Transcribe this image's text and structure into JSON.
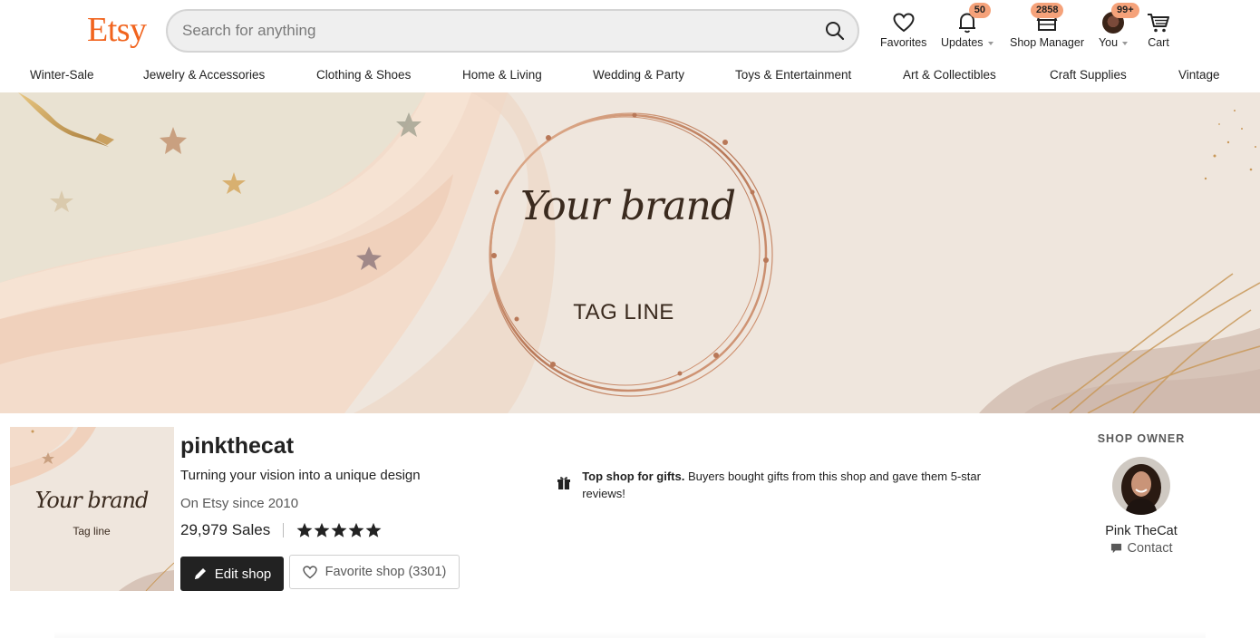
{
  "header": {
    "logo": "Etsy",
    "search": {
      "placeholder": "Search for anything",
      "value": ""
    },
    "actions": {
      "favorites": {
        "label": "Favorites",
        "icon": "heart-icon"
      },
      "updates": {
        "label": "Updates",
        "badge": "50",
        "icon": "bell-icon"
      },
      "shop_manager": {
        "label": "Shop Manager",
        "badge": "2858",
        "icon": "shop-icon"
      },
      "you": {
        "label": "You",
        "badge": "99+",
        "icon": "avatar"
      },
      "cart": {
        "label": "Cart",
        "icon": "cart-icon"
      }
    }
  },
  "categories": [
    "Winter-Sale",
    "Jewelry & Accessories",
    "Clothing & Shoes",
    "Home & Living",
    "Wedding & Party",
    "Toys & Entertainment",
    "Art & Collectibles",
    "Craft Supplies",
    "Vintage"
  ],
  "banner": {
    "brand": "Your brand",
    "tagline": "TAG LINE"
  },
  "shop": {
    "name": "pinkthecat",
    "tagline": "Turning your vision into a unique design",
    "since": "On Etsy since 2010",
    "sales": "29,979 Sales",
    "rating": 5,
    "logo_brand": "Your brand",
    "logo_tagline": "Tag line",
    "edit_label": "Edit shop",
    "favorite_label": "Favorite shop (3301)"
  },
  "gift_notice": {
    "bold": "Top shop for gifts.",
    "text": " Buyers bought gifts from this shop and gave them 5-star reviews!"
  },
  "owner": {
    "title": "SHOP OWNER",
    "name": "Pink TheCat",
    "contact_label": "Contact"
  },
  "colors": {
    "brand": "#F1641E",
    "badge": "#F5A27A",
    "banner_bg": "#EFE6DD",
    "rose_gold": "#C88A6A"
  }
}
